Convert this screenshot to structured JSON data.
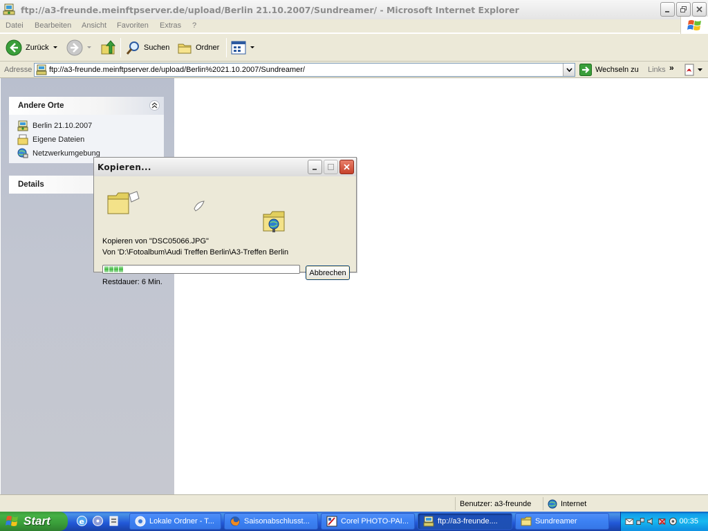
{
  "window": {
    "title": "ftp://a3-freunde.meinftpserver.de/upload/Berlin 21.10.2007/Sundreamer/ - Microsoft Internet Explorer"
  },
  "menu": [
    "Datei",
    "Bearbeiten",
    "Ansicht",
    "Favoriten",
    "Extras",
    "?"
  ],
  "toolbar": {
    "back_label": "Zurück",
    "search_label": "Suchen",
    "folders_label": "Ordner"
  },
  "address": {
    "label": "Adresse",
    "value": "ftp://a3-freunde.meinftpserver.de/upload/Berlin%2021.10.2007/Sundreamer/",
    "go_label": "Wechseln zu",
    "links_label": "Links"
  },
  "sidebar": {
    "other_places": {
      "title": "Andere Orte",
      "items": [
        "Berlin 21.10.2007",
        "Eigene Dateien",
        "Netzwerkumgebung"
      ]
    },
    "details": {
      "title": "Details"
    }
  },
  "dialog": {
    "title": "Kopieren...",
    "copying_line": "Kopieren von \"DSC05066.JPG\"",
    "from_line": "Von 'D:\\Fotoalbum\\Audi Treffen Berlin\\A3-Treffen Berlin",
    "cancel_label": "Abbrechen",
    "remaining": "Restdauer: 6 Min.",
    "progress_fraction": 0.09
  },
  "status": {
    "user": "Benutzer: a3-freunde",
    "zone": "Internet"
  },
  "taskbar": {
    "start_label": "Start",
    "tasks": [
      "Lokale Ordner - T...",
      "Saisonabschlusst...",
      "Corel PHOTO-PAI...",
      "ftp://a3-freunde....",
      "Sundreamer"
    ],
    "clock": "00:35"
  },
  "colors": {
    "xp_blue": "#2157d7",
    "start_green": "#3a9e3a",
    "sidebar": "#c2c6d1",
    "chrome": "#ece9d8"
  }
}
